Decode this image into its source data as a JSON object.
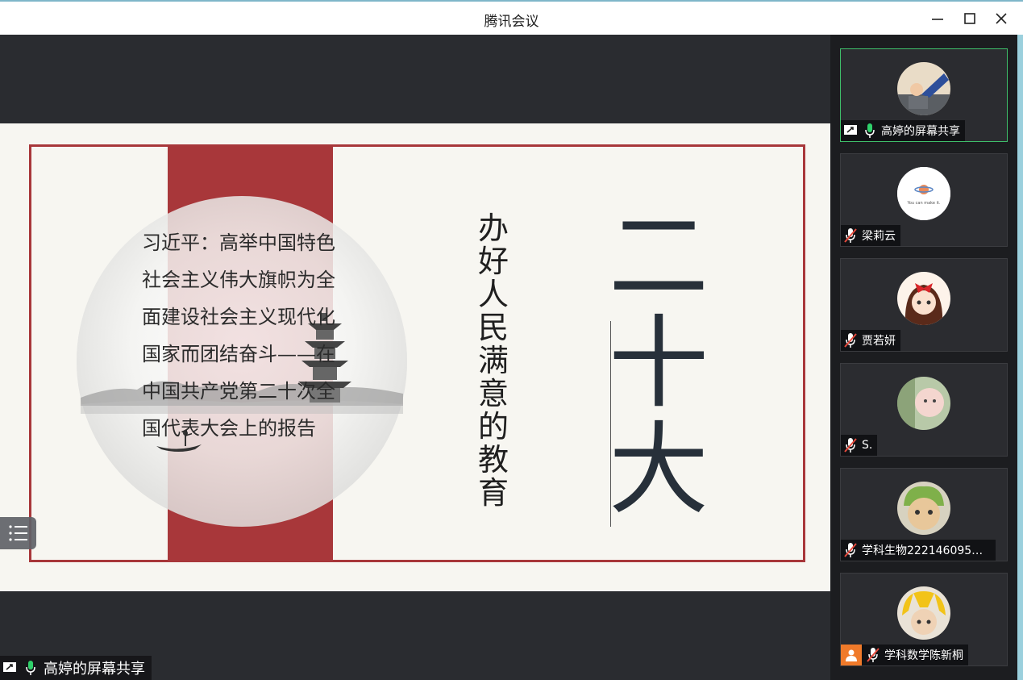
{
  "window": {
    "title": "腾讯会议"
  },
  "slide": {
    "report_title": "习近平：高举中国特色社会主义伟大旗帜为全面建设社会主义现代化国家而团结奋斗——在中国共产党第二十次全国代表大会上的报告",
    "vertical_title": "办好人民满意的教育",
    "big_title": "二十大"
  },
  "share_tag": {
    "label": "高婷的屏幕共享"
  },
  "participants": [
    {
      "name": "高婷的屏幕共享",
      "sharing": true,
      "mic": "on"
    },
    {
      "name": "梁莉云",
      "sharing": false,
      "mic": "muted",
      "avatar_caption": "You can make it."
    },
    {
      "name": "贾若妍",
      "sharing": false,
      "mic": "muted"
    },
    {
      "name": "S.",
      "sharing": false,
      "mic": "muted"
    },
    {
      "name": "学科生物222146095崔...",
      "sharing": false,
      "mic": "muted"
    },
    {
      "name": "学科数学陈新桐",
      "sharing": false,
      "mic": "muted",
      "host_badge": true
    }
  ],
  "colors": {
    "accent_red": "#a8373a",
    "active_border": "#3fbf6a",
    "mic_green": "#2fd06a",
    "mute_red": "#e64a3d"
  }
}
